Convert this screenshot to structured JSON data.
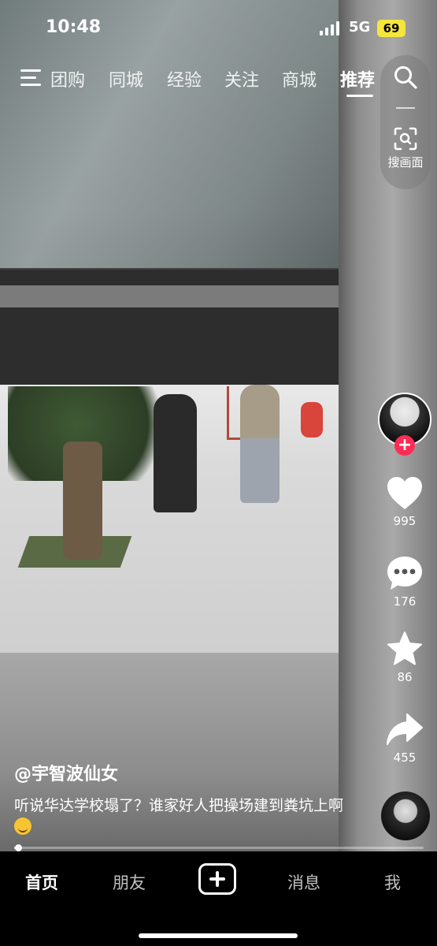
{
  "status_bar": {
    "time": "10:48",
    "network": "5G",
    "battery": "69"
  },
  "top_nav": {
    "tabs": [
      {
        "label": "团购"
      },
      {
        "label": "同城"
      },
      {
        "label": "经验"
      },
      {
        "label": "关注"
      },
      {
        "label": "商城"
      },
      {
        "label": "推荐",
        "active": true
      }
    ],
    "scan_label": "搜画面"
  },
  "actions": {
    "likes": "995",
    "comments": "176",
    "favorites": "86",
    "shares": "455"
  },
  "post": {
    "author": "@宇智波仙女",
    "caption": "听说华达学校塌了？谁家好人把操场建到粪坑上啊",
    "progress": 0.01
  },
  "bottom_tabs": {
    "home": "首页",
    "friends": "朋友",
    "messages": "消息",
    "me": "我"
  },
  "colors": {
    "accent": "#fe2c55",
    "battery": "#f5e63c"
  }
}
